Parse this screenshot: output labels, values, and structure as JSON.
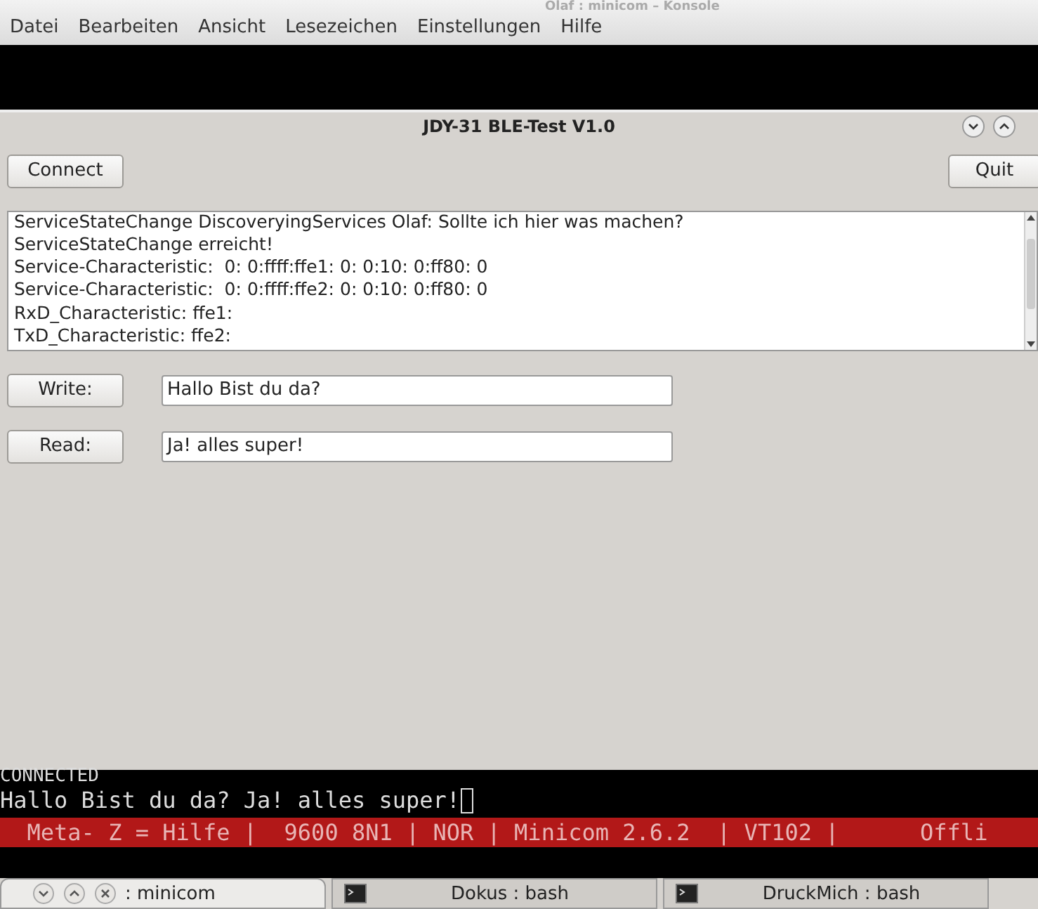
{
  "konsole": {
    "title": "Olaf : minicom – Konsole",
    "menu": [
      "Datei",
      "Bearbeiten",
      "Ansicht",
      "Lesezeichen",
      "Einstellungen",
      "Hilfe"
    ]
  },
  "dialog": {
    "title": "JDY-31 BLE-Test V1.0",
    "connect_button": "Connect",
    "quit_button": "Quit",
    "log": [
      "ServiceStateChange DiscoveryingServices Olaf: Sollte ich hier was machen?",
      "ServiceStateChange erreicht!",
      "Service-Characteristic:  0: 0:ffff:ffe1: 0: 0:10: 0:ff80: 0",
      "Service-Characteristic:  0: 0:ffff:ffe2: 0: 0:10: 0:ff80: 0",
      "RxD_Characteristic: ffe1:",
      "TxD_Characteristic: ffe2:"
    ],
    "rows": [
      {
        "button": "Write:",
        "value": "Hallo Bist du da?"
      },
      {
        "button": "Read:",
        "value": "Ja! alles super!"
      }
    ]
  },
  "terminal": {
    "lines": [
      "CONNECTED",
      "Hallo Bist du da? Ja! alles super!"
    ],
    "status_bar": "  Meta- Z = Hilfe |  9600 8N1 | NOR | Minicom 2.6.2  | VT102 |      Offli"
  },
  "taskbar": [
    {
      "label": ": minicom",
      "kind": "window-controls",
      "selected": true
    },
    {
      "label": "Dokus : bash",
      "kind": "terminal",
      "selected": false
    },
    {
      "label": "DruckMich : bash",
      "kind": "terminal",
      "selected": false
    }
  ]
}
